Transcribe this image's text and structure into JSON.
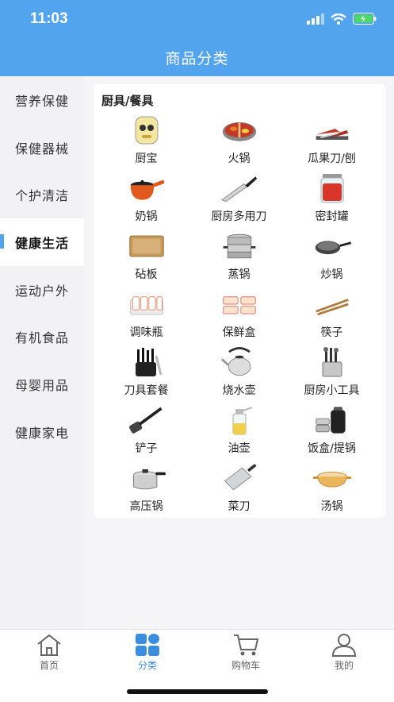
{
  "status": {
    "time": "11:03"
  },
  "header": {
    "title": "商品分类"
  },
  "sidebar": {
    "items": [
      {
        "label": "营养保健"
      },
      {
        "label": "保健器械"
      },
      {
        "label": "个护清洁"
      },
      {
        "label": "健康生活",
        "active": true
      },
      {
        "label": "运动户外"
      },
      {
        "label": "有机食品"
      },
      {
        "label": "母婴用品"
      },
      {
        "label": "健康家电"
      }
    ]
  },
  "section": {
    "title": "厨具/餐具",
    "items": [
      {
        "label": "厨宝",
        "icon": "water-heater-icon"
      },
      {
        "label": "火锅",
        "icon": "hotpot-icon"
      },
      {
        "label": "瓜果刀/刨",
        "icon": "fruit-knife-icon"
      },
      {
        "label": "奶锅",
        "icon": "milk-pot-icon"
      },
      {
        "label": "厨房多用刀",
        "icon": "kitchen-knife-icon"
      },
      {
        "label": "密封罐",
        "icon": "sealed-jar-icon"
      },
      {
        "label": "砧板",
        "icon": "cutting-board-icon"
      },
      {
        "label": "蒸锅",
        "icon": "steamer-icon"
      },
      {
        "label": "炒锅",
        "icon": "wok-icon"
      },
      {
        "label": "调味瓶",
        "icon": "seasoning-jar-icon"
      },
      {
        "label": "保鲜盒",
        "icon": "food-container-icon"
      },
      {
        "label": "筷子",
        "icon": "chopsticks-icon"
      },
      {
        "label": "刀具套餐",
        "icon": "knife-set-icon"
      },
      {
        "label": "烧水壶",
        "icon": "kettle-icon"
      },
      {
        "label": "厨房小工具",
        "icon": "kitchen-tools-icon"
      },
      {
        "label": "铲子",
        "icon": "spatula-icon"
      },
      {
        "label": "油壶",
        "icon": "oil-bottle-icon"
      },
      {
        "label": "饭盒/提锅",
        "icon": "lunch-box-icon"
      },
      {
        "label": "高压锅",
        "icon": "pressure-cooker-icon"
      },
      {
        "label": "菜刀",
        "icon": "cleaver-icon"
      },
      {
        "label": "汤锅",
        "icon": "soup-pot-icon"
      }
    ]
  },
  "tabbar": {
    "tabs": [
      {
        "label": "首页",
        "icon": "home-icon"
      },
      {
        "label": "分类",
        "icon": "category-icon",
        "active": true
      },
      {
        "label": "购物车",
        "icon": "cart-icon"
      },
      {
        "label": "我的",
        "icon": "user-icon"
      }
    ]
  },
  "colors": {
    "accent": "#53a4ee",
    "active_tab": "#3a8ee0"
  }
}
